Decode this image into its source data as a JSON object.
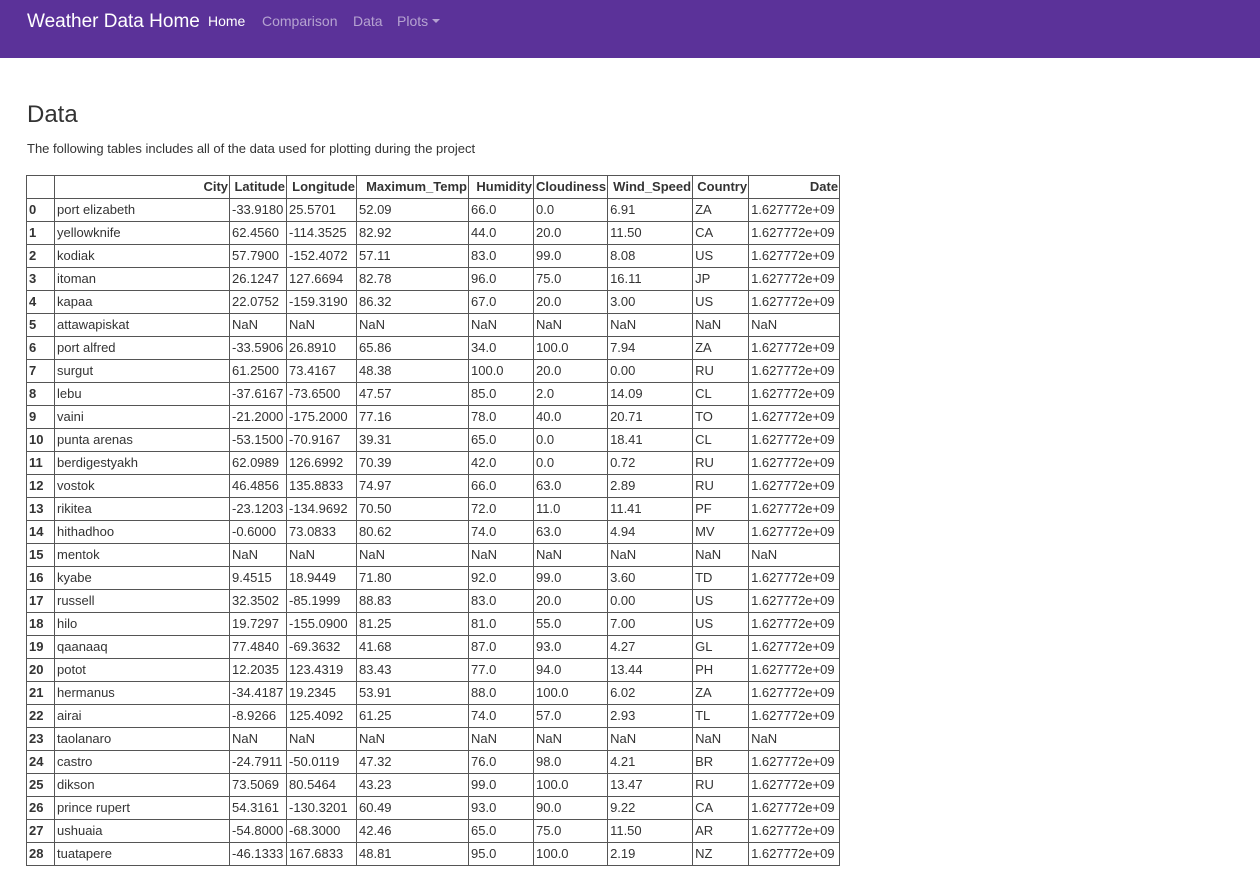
{
  "navbar": {
    "brand": "Weather Data Home",
    "links": [
      {
        "label": "Home",
        "active": true
      },
      {
        "label": "Comparison",
        "active": false
      },
      {
        "label": "Data",
        "active": false
      },
      {
        "label": "Plots",
        "active": false,
        "dropdown": true
      }
    ],
    "colors": {
      "background": "#5b3299",
      "active_text": "#ffffff",
      "inactive_text": "#b9a6d6"
    }
  },
  "page": {
    "title": "Data",
    "description": "The following tables includes all of the data used for plotting during the project"
  },
  "table": {
    "columns": [
      "",
      "City",
      "Latitude",
      "Longitude",
      "Maximum_Temp",
      "Humidity",
      "Cloudiness",
      "Wind_Speed",
      "Country",
      "Date"
    ],
    "rows": [
      [
        "0",
        "port elizabeth",
        "-33.9180",
        "25.5701",
        "52.09",
        "66.0",
        "0.0",
        "6.91",
        "ZA",
        "1.627772e+09"
      ],
      [
        "1",
        "yellowknife",
        "62.4560",
        "-114.3525",
        "82.92",
        "44.0",
        "20.0",
        "11.50",
        "CA",
        "1.627772e+09"
      ],
      [
        "2",
        "kodiak",
        "57.7900",
        "-152.4072",
        "57.11",
        "83.0",
        "99.0",
        "8.08",
        "US",
        "1.627772e+09"
      ],
      [
        "3",
        "itoman",
        "26.1247",
        "127.6694",
        "82.78",
        "96.0",
        "75.0",
        "16.11",
        "JP",
        "1.627772e+09"
      ],
      [
        "4",
        "kapaa",
        "22.0752",
        "-159.3190",
        "86.32",
        "67.0",
        "20.0",
        "3.00",
        "US",
        "1.627772e+09"
      ],
      [
        "5",
        "attawapiskat",
        "NaN",
        "NaN",
        "NaN",
        "NaN",
        "NaN",
        "NaN",
        "NaN",
        "NaN"
      ],
      [
        "6",
        "port alfred",
        "-33.5906",
        "26.8910",
        "65.86",
        "34.0",
        "100.0",
        "7.94",
        "ZA",
        "1.627772e+09"
      ],
      [
        "7",
        "surgut",
        "61.2500",
        "73.4167",
        "48.38",
        "100.0",
        "20.0",
        "0.00",
        "RU",
        "1.627772e+09"
      ],
      [
        "8",
        "lebu",
        "-37.6167",
        "-73.6500",
        "47.57",
        "85.0",
        "2.0",
        "14.09",
        "CL",
        "1.627772e+09"
      ],
      [
        "9",
        "vaini",
        "-21.2000",
        "-175.2000",
        "77.16",
        "78.0",
        "40.0",
        "20.71",
        "TO",
        "1.627772e+09"
      ],
      [
        "10",
        "punta arenas",
        "-53.1500",
        "-70.9167",
        "39.31",
        "65.0",
        "0.0",
        "18.41",
        "CL",
        "1.627772e+09"
      ],
      [
        "11",
        "berdigestyakh",
        "62.0989",
        "126.6992",
        "70.39",
        "42.0",
        "0.0",
        "0.72",
        "RU",
        "1.627772e+09"
      ],
      [
        "12",
        "vostok",
        "46.4856",
        "135.8833",
        "74.97",
        "66.0",
        "63.0",
        "2.89",
        "RU",
        "1.627772e+09"
      ],
      [
        "13",
        "rikitea",
        "-23.1203",
        "-134.9692",
        "70.50",
        "72.0",
        "11.0",
        "11.41",
        "PF",
        "1.627772e+09"
      ],
      [
        "14",
        "hithadhoo",
        "-0.6000",
        "73.0833",
        "80.62",
        "74.0",
        "63.0",
        "4.94",
        "MV",
        "1.627772e+09"
      ],
      [
        "15",
        "mentok",
        "NaN",
        "NaN",
        "NaN",
        "NaN",
        "NaN",
        "NaN",
        "NaN",
        "NaN"
      ],
      [
        "16",
        "kyabe",
        "9.4515",
        "18.9449",
        "71.80",
        "92.0",
        "99.0",
        "3.60",
        "TD",
        "1.627772e+09"
      ],
      [
        "17",
        "russell",
        "32.3502",
        "-85.1999",
        "88.83",
        "83.0",
        "20.0",
        "0.00",
        "US",
        "1.627772e+09"
      ],
      [
        "18",
        "hilo",
        "19.7297",
        "-155.0900",
        "81.25",
        "81.0",
        "55.0",
        "7.00",
        "US",
        "1.627772e+09"
      ],
      [
        "19",
        "qaanaaq",
        "77.4840",
        "-69.3632",
        "41.68",
        "87.0",
        "93.0",
        "4.27",
        "GL",
        "1.627772e+09"
      ],
      [
        "20",
        "potot",
        "12.2035",
        "123.4319",
        "83.43",
        "77.0",
        "94.0",
        "13.44",
        "PH",
        "1.627772e+09"
      ],
      [
        "21",
        "hermanus",
        "-34.4187",
        "19.2345",
        "53.91",
        "88.0",
        "100.0",
        "6.02",
        "ZA",
        "1.627772e+09"
      ],
      [
        "22",
        "airai",
        "-8.9266",
        "125.4092",
        "61.25",
        "74.0",
        "57.0",
        "2.93",
        "TL",
        "1.627772e+09"
      ],
      [
        "23",
        "taolanaro",
        "NaN",
        "NaN",
        "NaN",
        "NaN",
        "NaN",
        "NaN",
        "NaN",
        "NaN"
      ],
      [
        "24",
        "castro",
        "-24.7911",
        "-50.0119",
        "47.32",
        "76.0",
        "98.0",
        "4.21",
        "BR",
        "1.627772e+09"
      ],
      [
        "25",
        "dikson",
        "73.5069",
        "80.5464",
        "43.23",
        "99.0",
        "100.0",
        "13.47",
        "RU",
        "1.627772e+09"
      ],
      [
        "26",
        "prince rupert",
        "54.3161",
        "-130.3201",
        "60.49",
        "93.0",
        "90.0",
        "9.22",
        "CA",
        "1.627772e+09"
      ],
      [
        "27",
        "ushuaia",
        "-54.8000",
        "-68.3000",
        "42.46",
        "65.0",
        "75.0",
        "11.50",
        "AR",
        "1.627772e+09"
      ],
      [
        "28",
        "tuatapere",
        "-46.1333",
        "167.6833",
        "48.81",
        "95.0",
        "100.0",
        "2.19",
        "NZ",
        "1.627772e+09"
      ]
    ]
  }
}
